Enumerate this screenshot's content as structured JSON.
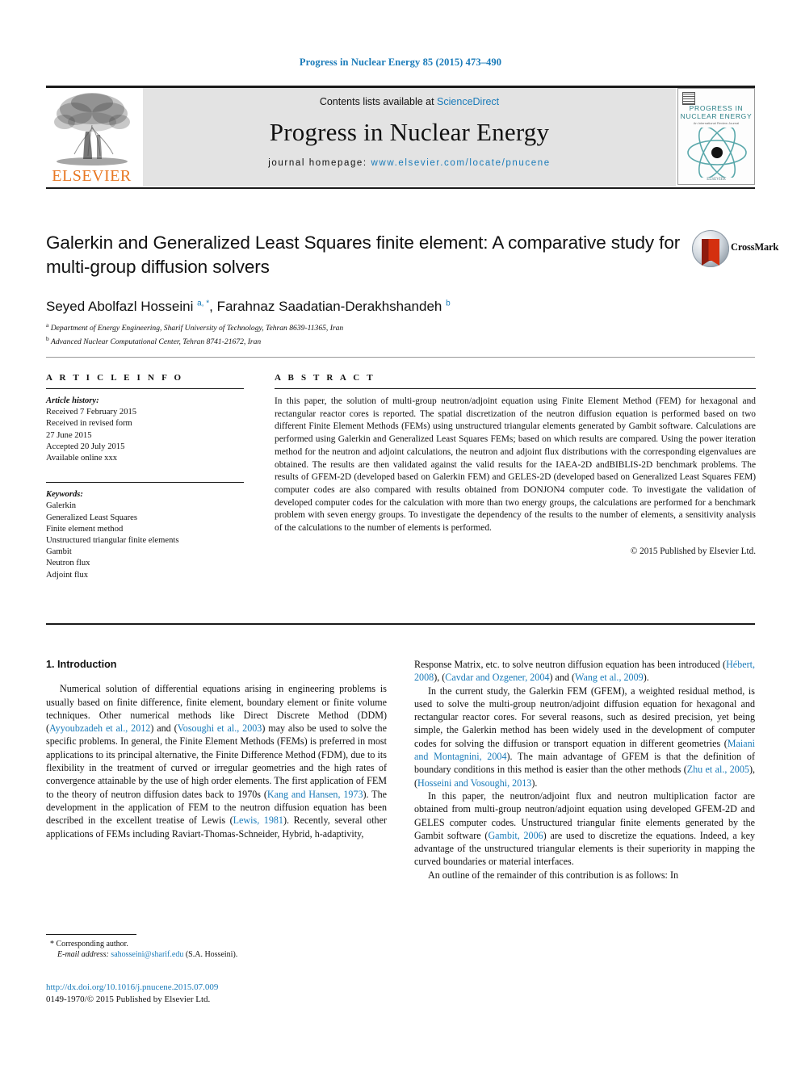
{
  "running_head": "Progress in Nuclear Energy 85 (2015) 473–490",
  "header": {
    "publisher": "ELSEVIER",
    "contents_prefix": "Contents lists available at ",
    "contents_link": "ScienceDirect",
    "journal_name": "Progress in Nuclear Energy",
    "homepage_prefix": "journal homepage: ",
    "homepage_url": "www.elsevier.com/locate/pnucene",
    "cover": {
      "line1": "PROGRESS IN",
      "line2": "NUCLEAR ENERGY",
      "line3": "An International Review Journal",
      "bottom": "ELSEVIER"
    }
  },
  "article": {
    "title": "Galerkin and Generalized Least Squares finite element: A comparative study for multi-group diffusion solvers",
    "crossmark_label": "CrossMark",
    "authors_part1": "Seyed Abolfazl Hosseini ",
    "authors_sup1": "a, *",
    "authors_part2": ", Farahnaz Saadatian-Derakhshandeh ",
    "authors_sup2": "b",
    "affiliation_a_sup": "a",
    "affiliation_a": " Department of Energy Engineering, Sharif University of Technology, Tehran 8639-11365, Iran",
    "affiliation_b_sup": "b",
    "affiliation_b": " Advanced Nuclear Computational Center, Tehran 8741-21672, Iran"
  },
  "article_info": {
    "heading": "A R T I C L E   I N F O",
    "history_label": "Article history:",
    "history": [
      "Received 7 February 2015",
      "Received in revised form",
      "27 June 2015",
      "Accepted 20 July 2015",
      "Available online xxx"
    ],
    "keywords_label": "Keywords:",
    "keywords": [
      "Galerkin",
      "Generalized Least Squares",
      "Finite element method",
      "Unstructured triangular finite elements",
      "Gambit",
      "Neutron flux",
      "Adjoint flux"
    ]
  },
  "abstract": {
    "heading": "A B S T R A C T",
    "text": "In this paper, the solution of multi-group neutron/adjoint equation using Finite Element Method (FEM) for hexagonal and rectangular reactor cores is reported. The spatial discretization of the neutron diffusion equation is performed based on two different Finite Element Methods (FEMs) using unstructured triangular elements generated by Gambit software. Calculations are performed using Galerkin and Generalized Least Squares FEMs; based on which results are compared. Using the power iteration method for the neutron and adjoint calculations, the neutron and adjoint flux distributions with the corresponding eigenvalues are obtained. The results are then validated against the valid results for the IAEA-2D andBIBLIS-2D benchmark problems. The results of GFEM-2D (developed based on Galerkin FEM) and GELES-2D (developed based on Generalized Least Squares FEM) computer codes are also compared with results obtained from DONJON4 computer code. To investigate the validation of developed computer codes for the calculation with more than two energy groups, the calculations are performed for a benchmark problem with seven energy groups. To investigate the dependency of the results to the number of elements, a sensitivity analysis of the calculations to the number of elements is performed.",
    "copyright": "© 2015 Published by Elsevier Ltd."
  },
  "introduction": {
    "heading": "1.  Introduction",
    "left_paragraph_1_a": "Numerical solution of differential equations arising in engineering problems is usually based on finite difference, finite element, boundary element or finite volume techniques. Other numerical methods like Direct Discrete Method (DDM) (",
    "left_ref_1": "Ayyoubzadeh et al., 2012",
    "left_paragraph_1_b": ") and (",
    "left_ref_2": "Vosoughi et al., 2003",
    "left_paragraph_1_c": ") may also be used to solve the specific problems. In general, the Finite Element Methods (FEMs) is preferred in most applications to its principal alternative, the Finite Difference Method (FDM), due to its flexibility in the treatment of curved or irregular geometries and the high rates of convergence attainable by the use of high order elements. The first application of FEM to the theory of neutron diffusion dates back to 1970s (",
    "left_ref_3": "Kang and Hansen, 1973",
    "left_paragraph_1_d": "). The development in the application of FEM to the neutron diffusion equation has been described in the excellent treatise of Lewis (",
    "left_ref_4": "Lewis, 1981",
    "left_paragraph_1_e": "). Recently, several other applications of FEMs including Raviart-Thomas-Schneider, Hybrid, h-adaptivity,",
    "right_paragraph_1_a": "Response Matrix, etc. to solve neutron diffusion equation has been introduced (",
    "right_ref_1": "Hébert, 2008",
    "right_paragraph_1_b": "), (",
    "right_ref_2": "Cavdar and Ozgener, 2004",
    "right_paragraph_1_c": ") and (",
    "right_ref_3": "Wang et al., 2009",
    "right_paragraph_1_d": ").",
    "right_paragraph_2_a": "In the current study, the Galerkin FEM (GFEM), a weighted residual method, is used to solve the multi-group neutron/adjoint diffusion equation for hexagonal and rectangular reactor cores. For several reasons, such as desired precision, yet being simple, the Galerkin method has been widely used in the development of computer codes for solving the diffusion or transport equation in different geometries (",
    "right_ref_4": "Maiani and Montagnini, 2004",
    "right_paragraph_2_b": "). The main advantage of GFEM is that the definition of boundary conditions in this method is easier than the other methods (",
    "right_ref_5": "Zhu et al., 2005",
    "right_paragraph_2_c": "), (",
    "right_ref_6": "Hosseini and Vosoughi, 2013",
    "right_paragraph_2_d": ").",
    "right_paragraph_3_a": "In this paper, the neutron/adjoint flux and neutron multiplication factor are obtained from multi-group neutron/adjoint equation using developed GFEM-2D and GELES computer codes. Unstructured triangular finite elements generated by the Gambit software (",
    "right_ref_7": "Gambit, 2006",
    "right_paragraph_3_b": ") are used to discretize the equations. Indeed, a key advantage of the unstructured triangular elements is their superiority in mapping the curved boundaries or material interfaces.",
    "right_paragraph_4": "An outline of the remainder of this contribution is as follows: In"
  },
  "footer": {
    "corresponding_marker": "*",
    "corresponding_author": "Corresponding author.",
    "email_label": "E-mail address:",
    "email": "sahosseini@sharif.edu",
    "email_owner": "(S.A. Hosseini).",
    "doi": "http://dx.doi.org/10.1016/j.pnucene.2015.07.009",
    "issn_line": "0149-1970/© 2015 Published by Elsevier Ltd."
  },
  "colors": {
    "link_blue": "#1a7bb9",
    "elsevier_orange": "#e87722",
    "band_grey": "#e3e3e3",
    "cover_teal": "#2a7f86"
  }
}
